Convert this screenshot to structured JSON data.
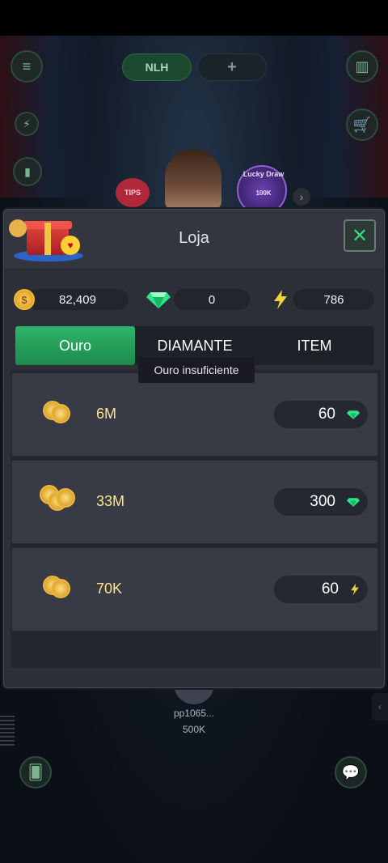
{
  "background": {
    "tabs": [
      "NLH",
      "+"
    ],
    "tips_label": "TIPS",
    "lucky_draw_label": "Lucky Draw",
    "lucky_draw_cost": "100K",
    "player": {
      "name": "pp1065...",
      "chips": "500K"
    }
  },
  "shop": {
    "title": "Loja",
    "balances": {
      "gold": "82,409",
      "diamond": "0",
      "energy": "786"
    },
    "tabs": [
      {
        "label": "Ouro",
        "active": true
      },
      {
        "label": "DIAMANTE",
        "active": false
      },
      {
        "label": "ITEM",
        "active": false
      }
    ],
    "tooltip": "Ouro insuficiente",
    "items": [
      {
        "amount": "6M",
        "price": "60",
        "currency": "diamond"
      },
      {
        "amount": "33M",
        "price": "300",
        "currency": "diamond"
      },
      {
        "amount": "70K",
        "price": "60",
        "currency": "energy"
      }
    ]
  },
  "colors": {
    "accent_green": "#2db56a",
    "gold_text": "#ffe68a",
    "modal_bg": "#2c2e38"
  }
}
